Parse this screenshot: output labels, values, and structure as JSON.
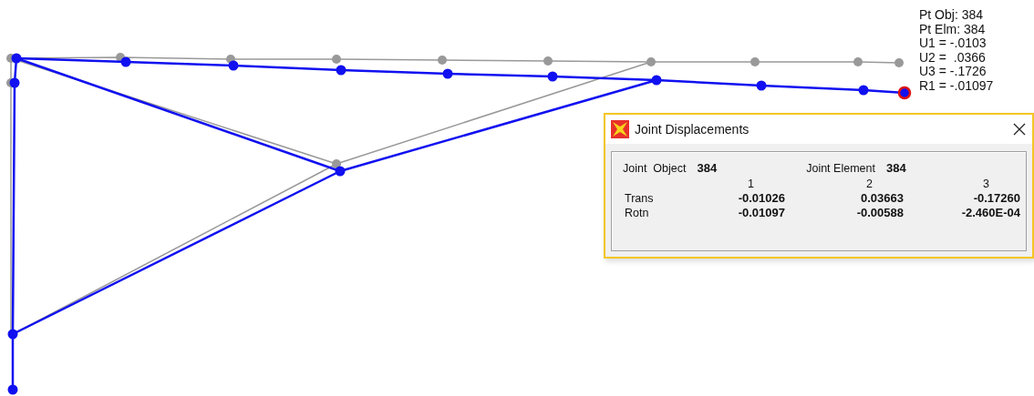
{
  "point_info": [
    "Pt Obj: 384",
    "Pt Elm: 384",
    "U1 = -.0103",
    "U2 =  .0366",
    "U3 = -.1726",
    "R1 = -.01097"
  ],
  "dialog": {
    "title": "Joint Displacements",
    "joint_object": {
      "label": "Joint  Object",
      "value": "384"
    },
    "joint_element": {
      "label": "Joint Element",
      "value": "384"
    },
    "columns": [
      "1",
      "2",
      "3"
    ],
    "rows": [
      {
        "label": "Trans",
        "values": [
          "-0.01026",
          "0.03663",
          "-0.17260"
        ]
      },
      {
        "label": "Rotn",
        "values": [
          "-0.01097",
          "-0.00588",
          "-2.460E-04"
        ]
      }
    ]
  }
}
